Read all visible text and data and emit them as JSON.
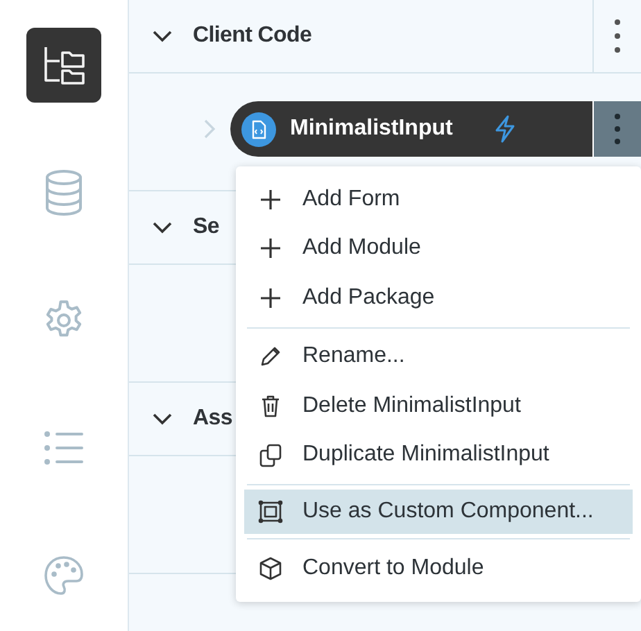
{
  "rail": [
    {
      "kind": "explorer",
      "selected": true
    },
    {
      "kind": "data",
      "selected": false
    },
    {
      "kind": "settings",
      "selected": false
    },
    {
      "kind": "list",
      "selected": false
    },
    {
      "kind": "theme",
      "selected": false
    }
  ],
  "sections": [
    {
      "title": "Client Code",
      "expanded": true,
      "items": [
        {
          "name": "MinimalistInput",
          "expanded": false,
          "selected": true
        }
      ]
    },
    {
      "title": "Se",
      "expanded": true
    },
    {
      "title": "Ass",
      "expanded": true
    }
  ],
  "menu": {
    "groups": [
      [
        {
          "kind": "add",
          "label": "Add Form",
          "selected": false
        },
        {
          "kind": "add",
          "label": "Add Module",
          "selected": false
        },
        {
          "kind": "add",
          "label": "Add Package",
          "selected": false
        }
      ],
      [
        {
          "kind": "rename",
          "label": "Rename...",
          "selected": false
        },
        {
          "kind": "delete",
          "label": "Delete MinimalistInput",
          "selected": false
        },
        {
          "kind": "duplicate",
          "label": "Duplicate MinimalistInput",
          "selected": false
        }
      ],
      [
        {
          "kind": "custom",
          "label": "Use as Custom Component...",
          "selected": true
        }
      ],
      [
        {
          "kind": "convert",
          "label": "Convert to Module",
          "selected": false
        }
      ]
    ]
  }
}
